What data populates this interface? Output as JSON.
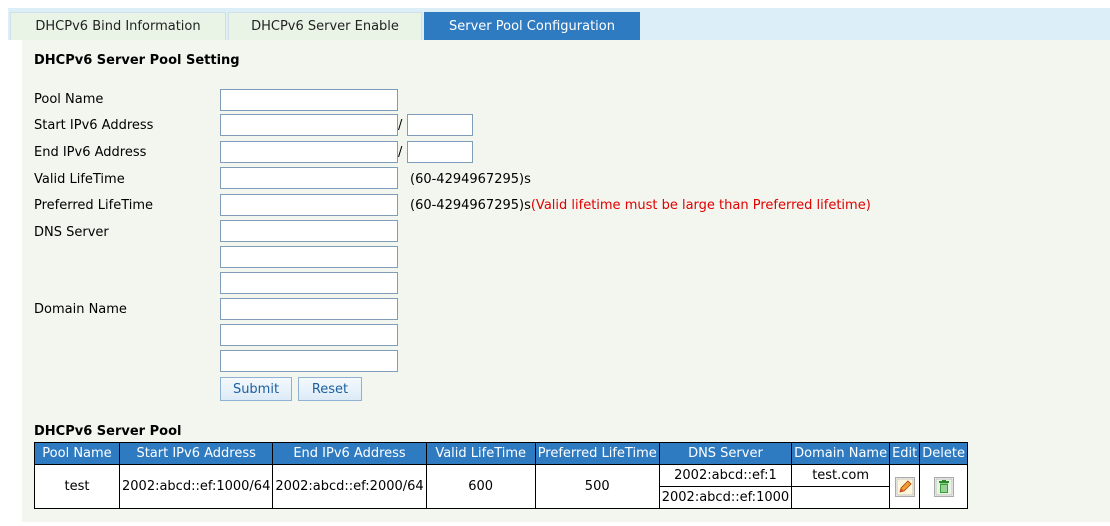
{
  "tabs": [
    {
      "label": "DHCPv6 Bind Information"
    },
    {
      "label": "DHCPv6 Server Enable"
    },
    {
      "label": "Server Pool Configuration",
      "active": true
    }
  ],
  "form": {
    "title": "DHCPv6 Server Pool Setting",
    "pool_name_label": "Pool Name",
    "start_label": "Start IPv6 Address",
    "end_label": "End IPv6 Address",
    "valid_label": "Valid LifeTime",
    "preferred_label": "Preferred LifeTime",
    "dns_label": "DNS Server",
    "domain_label": "Domain Name",
    "slash": "/",
    "range_hint": "(60-4294967295)s",
    "warning": "(Valid lifetime must be large than Preferred lifetime)",
    "submit_label": "Submit",
    "reset_label": "Reset"
  },
  "pool": {
    "title": "DHCPv6 Server Pool",
    "headers": [
      "Pool Name",
      "Start IPv6 Address",
      "End IPv6 Address",
      "Valid LifeTime",
      "Preferred LifeTime",
      "DNS Server",
      "Domain Name",
      "Edit",
      "Delete"
    ],
    "rows": [
      {
        "pool_name": "test",
        "start": "2002:abcd::ef:1000/64",
        "end": "2002:abcd::ef:2000/64",
        "valid": "600",
        "preferred": "500",
        "dns": [
          "2002:abcd::ef:1",
          "2002:abcd::ef:1000"
        ],
        "domain": "test.com"
      }
    ]
  },
  "colors": {
    "tab_active": "#2f7bc2",
    "warning": "#e00000",
    "panel": "#f3f6ef"
  },
  "icons": {
    "edit": "pencil-icon",
    "delete": "trash-icon"
  }
}
